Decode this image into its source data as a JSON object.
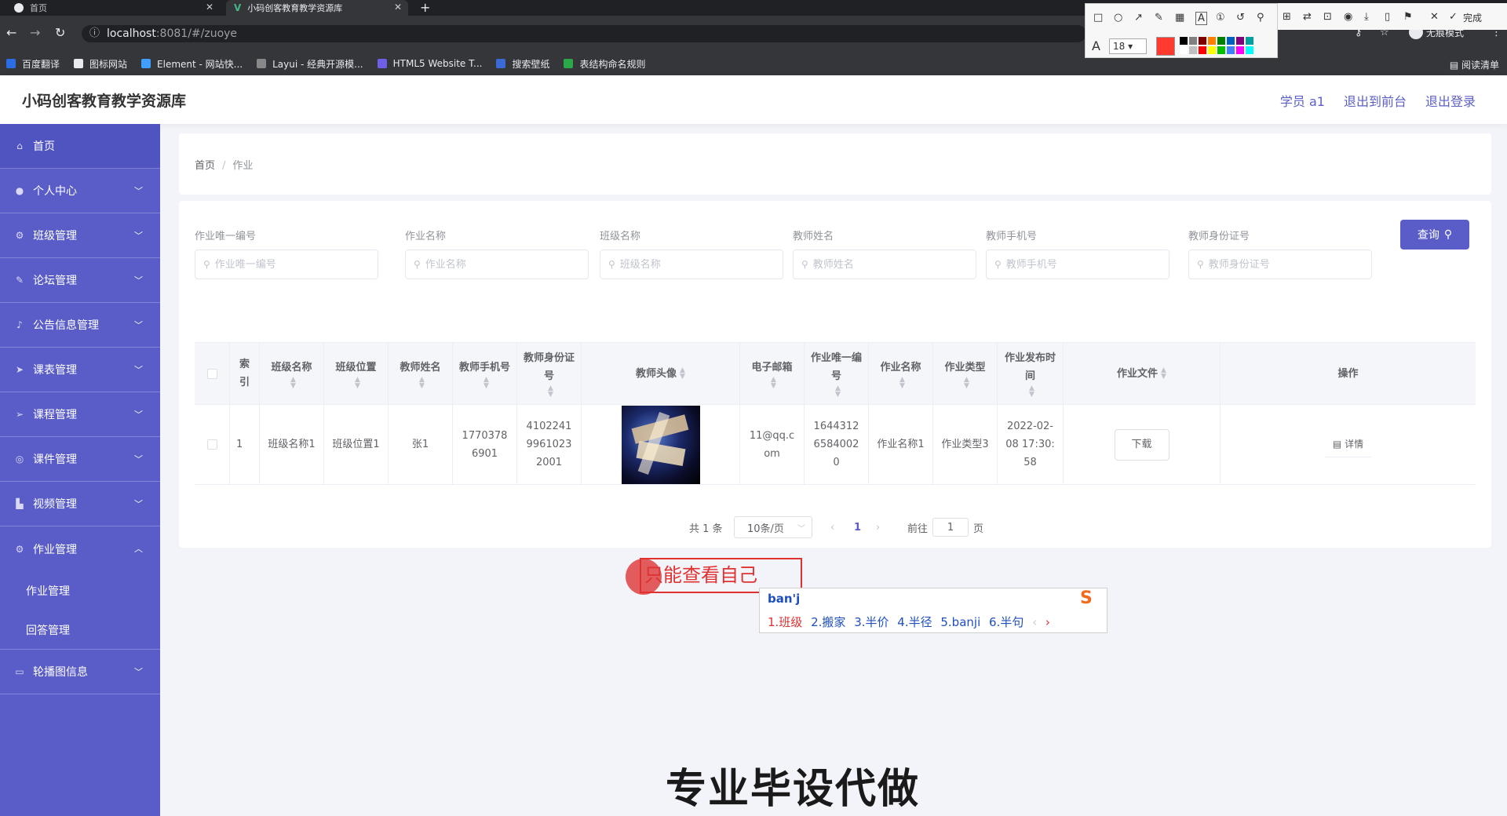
{
  "browser": {
    "tabs": [
      {
        "label": "首页"
      },
      {
        "label": "小码创客教育教学资源库"
      }
    ],
    "url_host": "localhost",
    "url_path": ":8081/#/zuoye",
    "incognito_label": "无痕模式",
    "bookmarks": [
      {
        "label": "百度翻译",
        "color": "#2b6de5"
      },
      {
        "label": "图标网站",
        "color": "#222222"
      },
      {
        "label": "Element - 网站快...",
        "color": "#409eff"
      },
      {
        "label": "Layui - 经典开源模...",
        "color": "#555555"
      },
      {
        "label": "HTML5 Website T...",
        "color": "#6f5ee8"
      },
      {
        "label": "搜索壁纸",
        "color": "#3b6ad6"
      },
      {
        "label": "表结构命名规则",
        "color": "#2aa84a"
      }
    ],
    "reading_list": "阅读清单"
  },
  "annotation_tool": {
    "font_size": "18",
    "done_label": "完成",
    "current_color": "#ff3b30",
    "palette": [
      "#000000",
      "#808080",
      "#800000",
      "#ff8000",
      "#008000",
      "#0060c0",
      "#800080",
      "#00a0a0",
      "#ffffff",
      "#c0c0c0",
      "#ff0000",
      "#ffff00",
      "#00c000",
      "#4080ff",
      "#ff00ff",
      "#00ffff"
    ]
  },
  "header": {
    "title": "小码创客教育教学资源库",
    "links": [
      "学员 a1",
      "退出到前台",
      "退出登录"
    ]
  },
  "sidebar": {
    "items": [
      {
        "label": "首页",
        "icon": "home-icon",
        "expandable": false
      },
      {
        "label": "个人中心",
        "icon": "user-icon",
        "expandable": true
      },
      {
        "label": "班级管理",
        "icon": "settings-icon",
        "expandable": true
      },
      {
        "label": "论坛管理",
        "icon": "edit-icon",
        "expandable": true
      },
      {
        "label": "公告信息管理",
        "icon": "mic-icon",
        "expandable": true
      },
      {
        "label": "课表管理",
        "icon": "send-icon",
        "expandable": true
      },
      {
        "label": "课程管理",
        "icon": "send-outline-icon",
        "expandable": true
      },
      {
        "label": "课件管理",
        "icon": "compass-icon",
        "expandable": true
      },
      {
        "label": "视频管理",
        "icon": "chart-icon",
        "expandable": true
      },
      {
        "label": "作业管理",
        "icon": "settings-icon",
        "expandable": true,
        "open": true
      },
      {
        "label": "轮播图信息",
        "icon": "monitor-icon",
        "expandable": true
      }
    ],
    "submenu": [
      "作业管理",
      "回答管理"
    ]
  },
  "breadcrumb": {
    "home": "首页",
    "separator": "/",
    "current": "作业"
  },
  "search": {
    "fields": [
      {
        "label": "作业唯一编号",
        "placeholder": "作业唯一编号"
      },
      {
        "label": "作业名称",
        "placeholder": "作业名称"
      },
      {
        "label": "班级名称",
        "placeholder": "班级名称"
      },
      {
        "label": "教师姓名",
        "placeholder": "教师姓名"
      },
      {
        "label": "教师手机号",
        "placeholder": "教师手机号"
      },
      {
        "label": "教师身份证号",
        "placeholder": "教师身份证号"
      }
    ],
    "button_label": "查询"
  },
  "table": {
    "headers": [
      "索引",
      "班级名称",
      "班级位置",
      "教师姓名",
      "教师手机号",
      "教师身份证号",
      "教师头像",
      "电子邮箱",
      "作业唯一编号",
      "作业名称",
      "作业类型",
      "作业发布时间",
      "作业文件",
      "操作"
    ],
    "rows": [
      {
        "index": "1",
        "class_name": "班级名称1",
        "class_location": "班级位置1",
        "teacher_name": "张1",
        "teacher_phone": "17703786901",
        "teacher_id": "410224199610232001",
        "email": "11@qq.com",
        "homework_id": "16443126584002 0",
        "homework_name": "作业名称1",
        "homework_type": "作业类型3",
        "publish_time": "2022-02-08 17:30:58",
        "file_button": "下载",
        "action_button": "详情"
      }
    ]
  },
  "pagination": {
    "total": "共 1 条",
    "page_size": "10条/页",
    "current_page": "1",
    "goto_label": "前往",
    "goto_value": "1",
    "page_suffix": "页"
  },
  "overlay": {
    "annotation_text": "只能查看自己",
    "ime_pinyin": "ban'j",
    "ime_candidates": [
      "1.班级",
      "2.搬家",
      "3.半价",
      "4.半径",
      "5.banji",
      "6.半句"
    ],
    "watermark": "专业毕设代做"
  }
}
